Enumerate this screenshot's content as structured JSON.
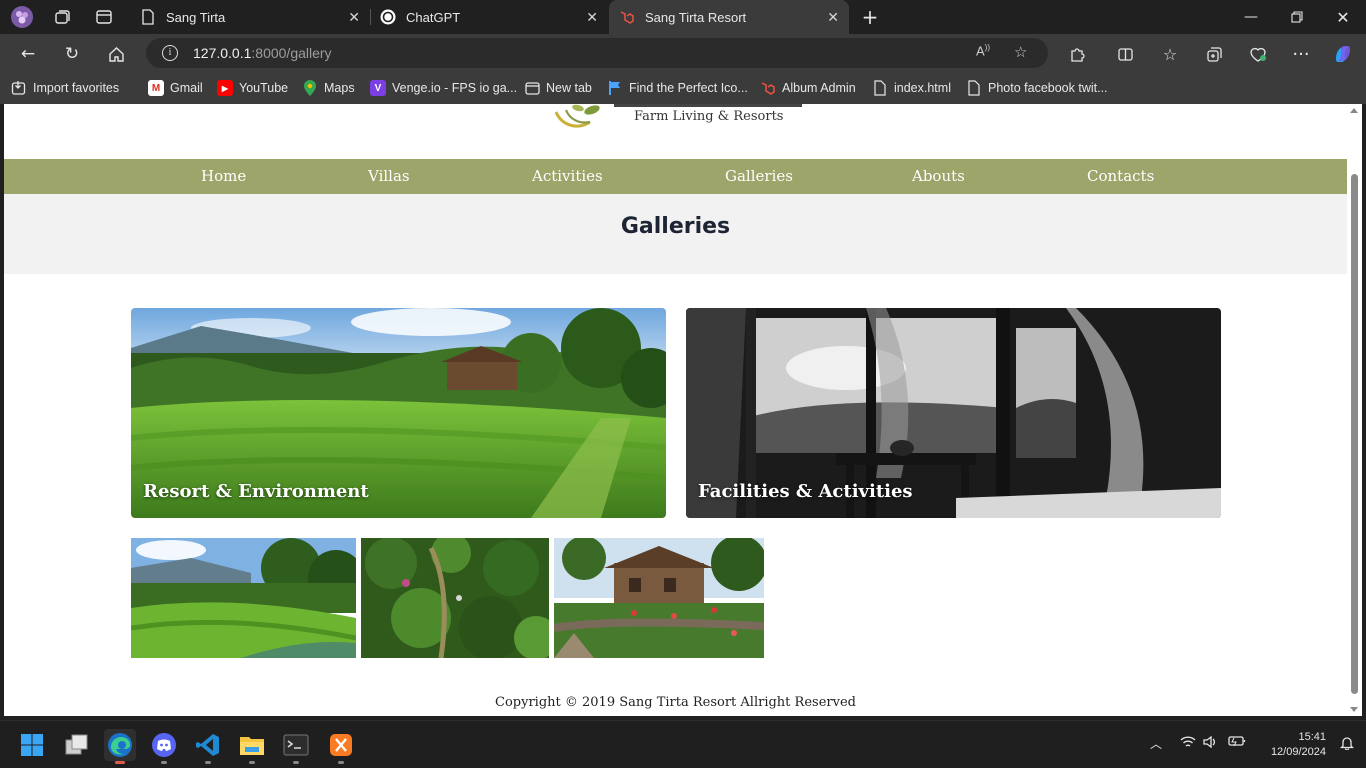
{
  "browser": {
    "tabs": [
      {
        "title": "Sang Tirta",
        "active": false
      },
      {
        "title": "ChatGPT",
        "active": false
      },
      {
        "title": "Sang Tirta Resort",
        "active": true
      }
    ],
    "url_host": "127.0.0.1",
    "url_rest": ":8000/gallery",
    "favorites": [
      {
        "label": "Import favorites",
        "icon": "import-icon"
      },
      {
        "label": "Gmail",
        "icon": "gmail-icon"
      },
      {
        "label": "YouTube",
        "icon": "youtube-icon"
      },
      {
        "label": "Maps",
        "icon": "maps-icon"
      },
      {
        "label": "Venge.io - FPS io ga...",
        "icon": "venge-icon"
      },
      {
        "label": "New tab",
        "icon": "new-tab-icon"
      },
      {
        "label": "Find the Perfect Ico...",
        "icon": "flag-icon"
      },
      {
        "label": "Album Admin",
        "icon": "laravel-icon"
      },
      {
        "label": "index.html",
        "icon": "file-icon"
      },
      {
        "label": "Photo facebook twit...",
        "icon": "file-icon"
      }
    ]
  },
  "site": {
    "logo_tagline": "Farm Living & Resorts",
    "menu": [
      "Home",
      "Villas",
      "Activities",
      "Galleries",
      "Abouts",
      "Contacts"
    ],
    "page_title": "Galleries",
    "cards": [
      {
        "title": "Resort & Environment"
      },
      {
        "title": "Facilities & Activities"
      }
    ],
    "copyright": "Copyright © 2019 Sang Tirta Resort Allright Reserved"
  },
  "taskbar": {
    "apps": [
      "start-icon",
      "task-view-icon",
      "edge-icon",
      "discord-icon",
      "vscode-icon",
      "file-explorer-icon",
      "terminal-icon",
      "xampp-icon"
    ],
    "time": "15:41",
    "date": "12/09/2024"
  },
  "colors": {
    "menu_bar": "#9da56a",
    "banner_bg": "#f2f2f2",
    "chrome_dark": "#202020",
    "chrome_toolbar": "#3b3b3b"
  }
}
